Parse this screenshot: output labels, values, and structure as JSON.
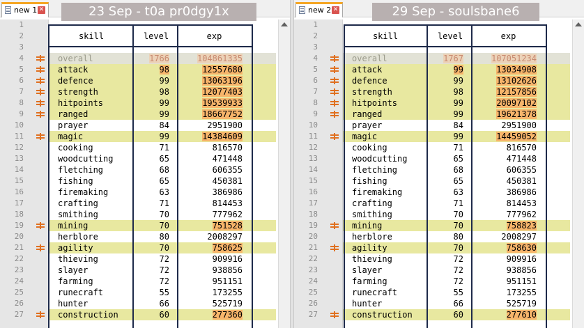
{
  "left_pane": {
    "tab_label": "new 1",
    "title": "23 Sep - t0a pr0dgy1x",
    "header": {
      "skill": "skill",
      "level": "level",
      "exp": "exp"
    },
    "rows": [
      {
        "skill": "overall",
        "level": "1766",
        "exp": "104861335",
        "marked": true,
        "level_changed": true,
        "exp_changed": true
      },
      {
        "skill": "attack",
        "level": "98",
        "exp": "12557680",
        "marked": true,
        "level_changed": true,
        "exp_changed": true
      },
      {
        "skill": "defence",
        "level": "99",
        "exp": "13063196",
        "marked": true,
        "level_changed": false,
        "exp_changed": true
      },
      {
        "skill": "strength",
        "level": "98",
        "exp": "12077403",
        "marked": true,
        "level_changed": false,
        "exp_changed": true
      },
      {
        "skill": "hitpoints",
        "level": "99",
        "exp": "19539933",
        "marked": true,
        "level_changed": false,
        "exp_changed": true
      },
      {
        "skill": "ranged",
        "level": "99",
        "exp": "18667752",
        "marked": true,
        "level_changed": false,
        "exp_changed": true
      },
      {
        "skill": "prayer",
        "level": "84",
        "exp": "2951900",
        "marked": false,
        "level_changed": false,
        "exp_changed": false
      },
      {
        "skill": "magic",
        "level": "99",
        "exp": "14384609",
        "marked": true,
        "level_changed": false,
        "exp_changed": true
      },
      {
        "skill": "cooking",
        "level": "71",
        "exp": "816570",
        "marked": false,
        "level_changed": false,
        "exp_changed": false
      },
      {
        "skill": "woodcutting",
        "level": "65",
        "exp": "471448",
        "marked": false,
        "level_changed": false,
        "exp_changed": false
      },
      {
        "skill": "fletching",
        "level": "68",
        "exp": "606355",
        "marked": false,
        "level_changed": false,
        "exp_changed": false
      },
      {
        "skill": "fishing",
        "level": "65",
        "exp": "450381",
        "marked": false,
        "level_changed": false,
        "exp_changed": false
      },
      {
        "skill": "firemaking",
        "level": "63",
        "exp": "386986",
        "marked": false,
        "level_changed": false,
        "exp_changed": false
      },
      {
        "skill": "crafting",
        "level": "71",
        "exp": "814453",
        "marked": false,
        "level_changed": false,
        "exp_changed": false
      },
      {
        "skill": "smithing",
        "level": "70",
        "exp": "777962",
        "marked": false,
        "level_changed": false,
        "exp_changed": false
      },
      {
        "skill": "mining",
        "level": "70",
        "exp": "751528",
        "marked": true,
        "level_changed": false,
        "exp_changed": true
      },
      {
        "skill": "herblore",
        "level": "80",
        "exp": "2008297",
        "marked": false,
        "level_changed": false,
        "exp_changed": false
      },
      {
        "skill": "agility",
        "level": "70",
        "exp": "758625",
        "marked": true,
        "level_changed": false,
        "exp_changed": true
      },
      {
        "skill": "thieving",
        "level": "72",
        "exp": "909916",
        "marked": false,
        "level_changed": false,
        "exp_changed": false
      },
      {
        "skill": "slayer",
        "level": "72",
        "exp": "938856",
        "marked": false,
        "level_changed": false,
        "exp_changed": false
      },
      {
        "skill": "farming",
        "level": "72",
        "exp": "951151",
        "marked": false,
        "level_changed": false,
        "exp_changed": false
      },
      {
        "skill": "runecraft",
        "level": "55",
        "exp": "173255",
        "marked": false,
        "level_changed": false,
        "exp_changed": false
      },
      {
        "skill": "hunter",
        "level": "66",
        "exp": "525719",
        "marked": false,
        "level_changed": false,
        "exp_changed": false
      },
      {
        "skill": "construction",
        "level": "60",
        "exp": "277360",
        "marked": true,
        "level_changed": false,
        "exp_changed": true
      }
    ]
  },
  "right_pane": {
    "tab_label": "new 2",
    "title": "29 Sep - soulsbane6",
    "header": {
      "skill": "skill",
      "level": "level",
      "exp": "exp"
    },
    "rows": [
      {
        "skill": "overall",
        "level": "1767",
        "exp": "107051234",
        "marked": true,
        "level_changed": true,
        "exp_changed": true
      },
      {
        "skill": "attack",
        "level": "99",
        "exp": "13034908",
        "marked": true,
        "level_changed": true,
        "exp_changed": true
      },
      {
        "skill": "defence",
        "level": "99",
        "exp": "13102626",
        "marked": true,
        "level_changed": false,
        "exp_changed": true
      },
      {
        "skill": "strength",
        "level": "98",
        "exp": "12157856",
        "marked": true,
        "level_changed": false,
        "exp_changed": true
      },
      {
        "skill": "hitpoints",
        "level": "99",
        "exp": "20097102",
        "marked": true,
        "level_changed": false,
        "exp_changed": true
      },
      {
        "skill": "ranged",
        "level": "99",
        "exp": "19621378",
        "marked": true,
        "level_changed": false,
        "exp_changed": true
      },
      {
        "skill": "prayer",
        "level": "84",
        "exp": "2951900",
        "marked": false,
        "level_changed": false,
        "exp_changed": false
      },
      {
        "skill": "magic",
        "level": "99",
        "exp": "14459052",
        "marked": true,
        "level_changed": false,
        "exp_changed": true
      },
      {
        "skill": "cooking",
        "level": "71",
        "exp": "816570",
        "marked": false,
        "level_changed": false,
        "exp_changed": false
      },
      {
        "skill": "woodcutting",
        "level": "65",
        "exp": "471448",
        "marked": false,
        "level_changed": false,
        "exp_changed": false
      },
      {
        "skill": "fletching",
        "level": "68",
        "exp": "606355",
        "marked": false,
        "level_changed": false,
        "exp_changed": false
      },
      {
        "skill": "fishing",
        "level": "65",
        "exp": "450381",
        "marked": false,
        "level_changed": false,
        "exp_changed": false
      },
      {
        "skill": "firemaking",
        "level": "63",
        "exp": "386986",
        "marked": false,
        "level_changed": false,
        "exp_changed": false
      },
      {
        "skill": "crafting",
        "level": "71",
        "exp": "814453",
        "marked": false,
        "level_changed": false,
        "exp_changed": false
      },
      {
        "skill": "smithing",
        "level": "70",
        "exp": "777962",
        "marked": false,
        "level_changed": false,
        "exp_changed": false
      },
      {
        "skill": "mining",
        "level": "70",
        "exp": "758823",
        "marked": true,
        "level_changed": false,
        "exp_changed": true
      },
      {
        "skill": "herblore",
        "level": "80",
        "exp": "2008297",
        "marked": false,
        "level_changed": false,
        "exp_changed": false
      },
      {
        "skill": "agility",
        "level": "70",
        "exp": "758630",
        "marked": true,
        "level_changed": false,
        "exp_changed": true
      },
      {
        "skill": "thieving",
        "level": "72",
        "exp": "909916",
        "marked": false,
        "level_changed": false,
        "exp_changed": false
      },
      {
        "skill": "slayer",
        "level": "72",
        "exp": "938856",
        "marked": false,
        "level_changed": false,
        "exp_changed": false
      },
      {
        "skill": "farming",
        "level": "72",
        "exp": "951151",
        "marked": false,
        "level_changed": false,
        "exp_changed": false
      },
      {
        "skill": "runecraft",
        "level": "55",
        "exp": "173255",
        "marked": false,
        "level_changed": false,
        "exp_changed": false
      },
      {
        "skill": "hunter",
        "level": "66",
        "exp": "525719",
        "marked": false,
        "level_changed": false,
        "exp_changed": false
      },
      {
        "skill": "construction",
        "level": "60",
        "exp": "277610",
        "marked": true,
        "level_changed": false,
        "exp_changed": true
      }
    ]
  },
  "colors": {
    "line_highlight": "#e8e8a0",
    "overall_highlight": "#e2e2d6",
    "changed_value": "#f7b56b",
    "diff_marker": "#e07020",
    "title_banner": "#b8b0b0",
    "table_border": "#1e2a4a",
    "active_tab_accent": "#f5a623"
  },
  "icons": {
    "tab_document": "document-icon",
    "tab_close": "close-icon",
    "diff_marker": "diff-marker-icon",
    "scroll_up": "scroll-up-arrow-icon"
  }
}
